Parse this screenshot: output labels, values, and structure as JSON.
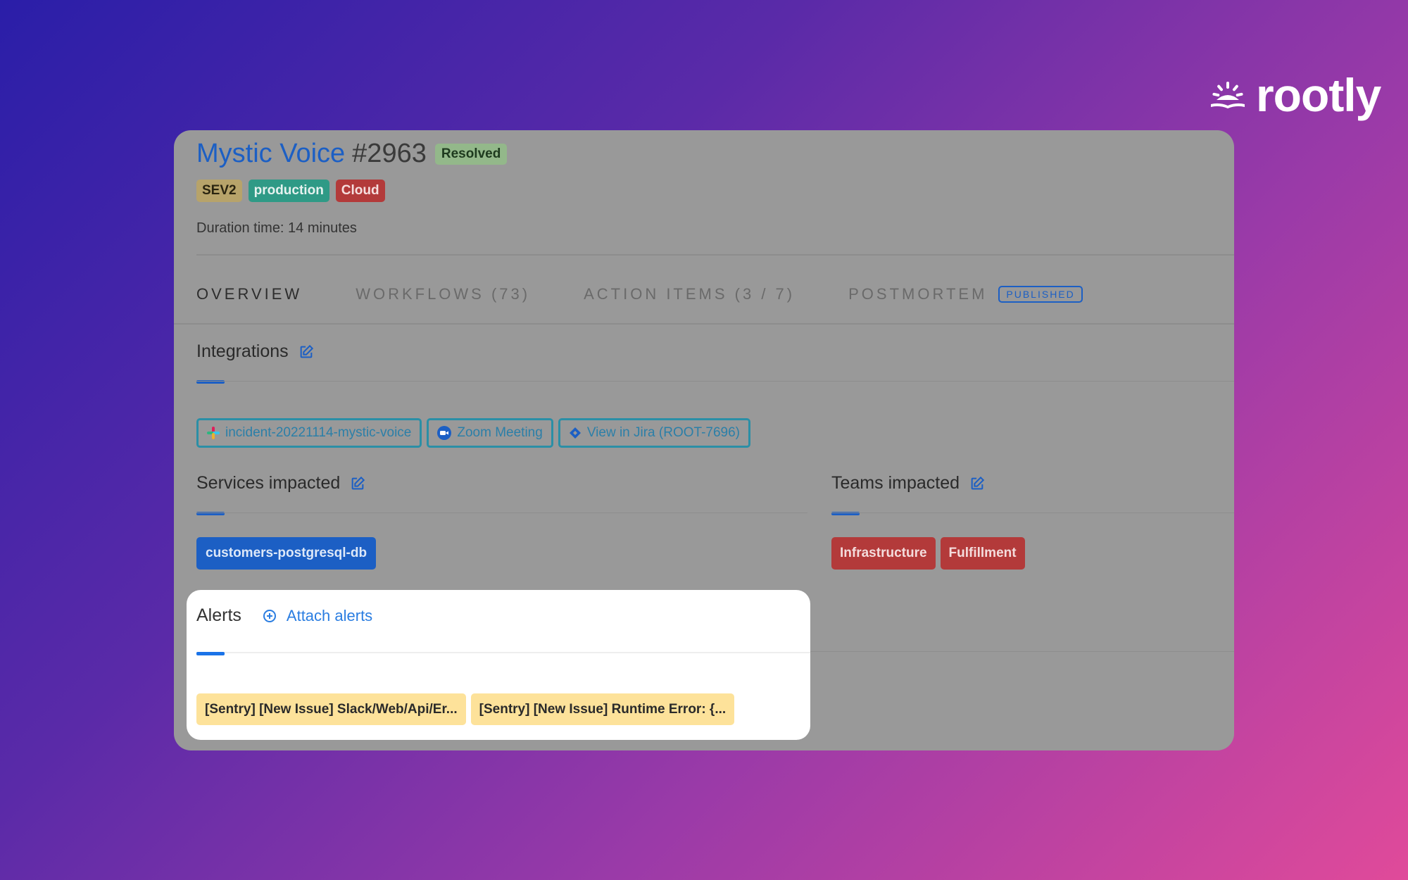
{
  "brand": {
    "name": "rootly"
  },
  "incident": {
    "name": "Mystic Voice",
    "number": "#2963",
    "status": "Resolved",
    "tags": [
      "SEV2",
      "production",
      "Cloud"
    ],
    "duration": "Duration time: 14 minutes"
  },
  "tabs": [
    {
      "label": "OVERVIEW"
    },
    {
      "label": "WORKFLOWS (73)"
    },
    {
      "label": "ACTION ITEMS (3 / 7)"
    },
    {
      "label": "POSTMORTEM",
      "badge": "PUBLISHED"
    }
  ],
  "integrations": {
    "title": "Integrations",
    "links": [
      {
        "label": "incident-20221114-mystic-voice",
        "icon": "slack-icon"
      },
      {
        "label": "Zoom Meeting",
        "icon": "zoom-icon"
      },
      {
        "label": "View in Jira (ROOT-7696)",
        "icon": "jira-icon"
      }
    ]
  },
  "services": {
    "title": "Services impacted",
    "items": [
      "customers-postgresql-db"
    ]
  },
  "teams": {
    "title": "Teams impacted",
    "items": [
      "Infrastructure",
      "Fulfillment"
    ]
  },
  "alerts": {
    "title": "Alerts",
    "attach_label": "Attach alerts",
    "items": [
      "[Sentry] [New Issue] Slack/Web/Api/Er...",
      "[Sentry] [New Issue] Runtime Error: {..."
    ]
  },
  "colors": {
    "accent": "#1c5fc4",
    "link": "#2a7de1",
    "resolved": "#93b88a",
    "danger": "#b33a3a",
    "alert_chip": "#fde29a"
  }
}
